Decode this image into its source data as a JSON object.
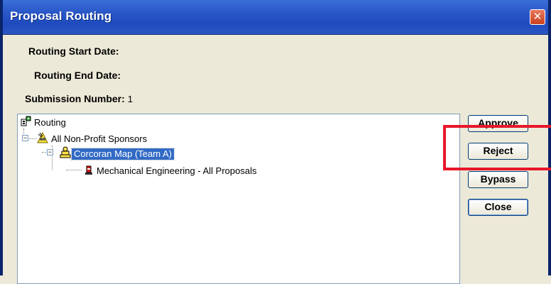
{
  "window": {
    "title": "Proposal Routing",
    "close_symbol": "✕"
  },
  "fields": {
    "start_date_label": "Routing Start Date:",
    "start_date_value": "",
    "end_date_label": "Routing End Date:",
    "end_date_value": "",
    "submission_label": "Submission Number:",
    "submission_value": "1"
  },
  "tree": {
    "root": {
      "label": "Routing",
      "icon": "routing-map-icon"
    },
    "sponsor": {
      "label": "All Non-Profit Sponsors",
      "icon": "sponsors-stop-icon",
      "expander": "−"
    },
    "map": {
      "label": "Corcoran Map (Team A)",
      "icon": "team-map-icon",
      "expander": "−",
      "selected": true
    },
    "stop": {
      "label": "Mechanical Engineering - All Proposals",
      "icon": "approver-stop-icon"
    }
  },
  "buttons": {
    "approve": "Approve",
    "reject": "Reject",
    "bypass": "Bypass",
    "close": "Close"
  },
  "colors": {
    "titlebar": "#245edb",
    "selection": "#316ac5",
    "highlight": "#e8172a"
  }
}
